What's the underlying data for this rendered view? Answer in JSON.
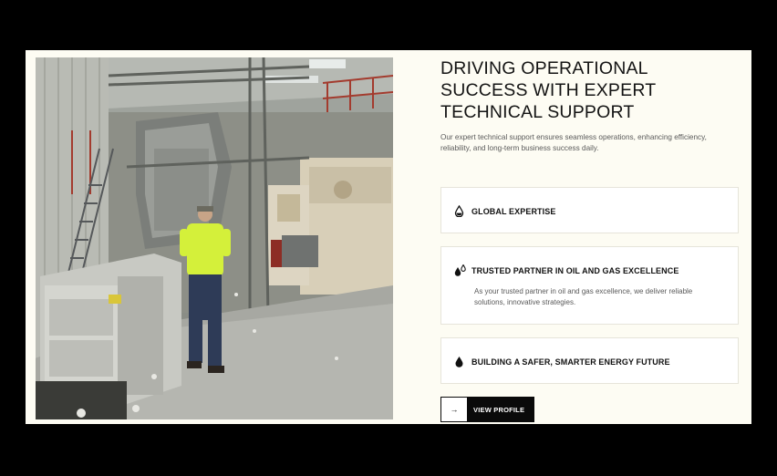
{
  "section": {
    "heading": "DRIVING OPERATIONAL SUCCESS WITH EXPERT TECHNICAL SUPPORT",
    "intro": "Our expert technical support ensures seamless operations, enhancing efficiency, reliability, and long-term business success daily."
  },
  "image": {
    "icon": "industrial-facility-photo"
  },
  "cards": [
    {
      "title": "GLOBAL EXPERTISE",
      "description": "",
      "icon": "oil-drop-icon"
    },
    {
      "title": "TRUSTED PARTNER IN OIL AND GAS EXCELLENCE",
      "description": "As your trusted partner in oil and gas excellence, we deliver reliable solutions, innovative strategies.",
      "icon": "oil-drops-icon"
    },
    {
      "title": "BUILDING A SAFER, SMARTER ENERGY FUTURE",
      "description": "",
      "icon": "oil-drop-icon"
    }
  ],
  "button": {
    "label": "VIEW PROFILE",
    "arrow": "→"
  },
  "colors": {
    "background": "#000000",
    "panel": "#fdfcf3",
    "card": "#ffffff",
    "button": "#0a0a0a",
    "worker_vest": "#d4f03a"
  }
}
